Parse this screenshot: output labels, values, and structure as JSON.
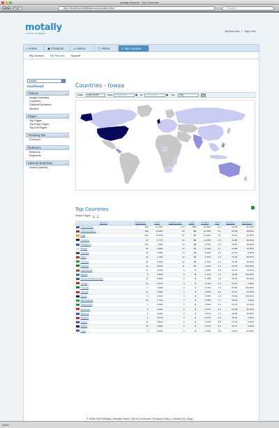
{
  "window": {
    "title": "motally Reports - Top Countries"
  },
  "browser": {
    "url": "http://localhost:8888/demo/countries.html",
    "search_placeholder": "Google",
    "status": "Done"
  },
  "brand": {
    "logo": "motally",
    "tagline": "mobile analytics"
  },
  "toplinks": {
    "account": "My Account",
    "separator": "|",
    "signout": "Sign Out"
  },
  "tabs": [
    "Home",
    "Products",
    "Demo",
    "About",
    "My Account"
  ],
  "subnav": [
    "My Account",
    "My Reports",
    "Support"
  ],
  "sidebar": {
    "select_value": "towza",
    "dashboard": "Dashboard",
    "sections": [
      {
        "title": "Visitors",
        "items": [
          "Usage Summary",
          "Countries",
          "Carriers/Operators",
          "Devices"
        ]
      },
      {
        "title": "Pages",
        "items": [
          "Top Pages",
          "Top Entry Pages",
          "Top Exit Pages"
        ]
      },
      {
        "title": "Tracking IDs",
        "items": [
          "Overview"
        ]
      },
      {
        "title": "Referrers",
        "items": [
          "Referrers",
          "Keywords"
        ]
      },
      {
        "title": "Internal Searches",
        "items": [
          "Search Queries"
        ]
      }
    ]
  },
  "main": {
    "title": "Countries - towza",
    "date": {
      "label": "Date:",
      "preset": "Last month",
      "from_label": "from:",
      "from": "10/01/2008",
      "to_label": "to:",
      "to": "10/27/2008",
      "by_label": "by:",
      "by": "Day",
      "go": "Go"
    },
    "table_title": "Top Countries",
    "pages_label": "Result Pages:",
    "page_nums": [
      "1",
      "2"
    ]
  },
  "colors": {
    "accent": "#2b6fb0",
    "map_high": "#0a0a5c",
    "map_mid": "#8f92d8",
    "map_low": "#c9cbf0",
    "map_none": "#c8c8c8"
  },
  "table": {
    "columns": [
      "Country",
      "Pageviews",
      "% PV",
      "Unique Users",
      "Visits",
      "% Visits",
      "PPV",
      "Avg Time",
      "Bounce %"
    ],
    "rows": [
      [
        "United States",
        "366",
        "27.23%",
        "173",
        "173",
        "31.96%",
        "2.1",
        "00:48",
        "67.63%"
      ],
      [
        "United Kingdom",
        "189",
        "14.08%",
        "89",
        "89",
        "16.39%",
        "2.1",
        "00:56",
        "68.54%"
      ],
      [
        "India",
        "264",
        "19.64%",
        "67",
        "67",
        "12.34%",
        "3.9",
        "03:21",
        "34.33%"
      ],
      [
        "Germany",
        "91",
        "6.77%",
        "60",
        "60",
        "11.05%",
        "1.5",
        "00:05",
        "90.00%"
      ],
      [
        "Philippines",
        "100",
        "7.44%",
        "19",
        "19",
        "3.50%",
        "5.3",
        "05:03",
        "36.84%"
      ],
      [
        "Russia",
        "35",
        "2.60%",
        "17",
        "17",
        "3.13%",
        "2.1",
        "00:08",
        "70.59%"
      ],
      [
        "Australia",
        "32",
        "2.38%",
        "13",
        "13",
        "2.39%",
        "2.5",
        "01:20",
        "0.00%"
      ],
      [
        "China",
        "16",
        "1.19%",
        "12",
        "12",
        "2.21%",
        "1.3",
        "00:02",
        "66.67%"
      ],
      [
        "Jamaica",
        "41",
        "3.05%",
        "12",
        "12",
        "2.21%",
        "3.4",
        "02:04",
        "33.33%"
      ],
      [
        "Pakistan",
        "11",
        "0.82%",
        "11",
        "11",
        "2.03%",
        "1.0",
        "00:00",
        "100.00%"
      ],
      [
        "Netherlands",
        "27",
        "2.01%",
        "9",
        "9",
        "1.66%",
        "3.0",
        "00:10",
        "11.11%"
      ],
      [
        "Nigeria",
        "8",
        "0.60%",
        "8",
        "8",
        "1.47%",
        "1.0",
        "00:00",
        "100.00%"
      ],
      [
        "Serbia and Montenegro",
        "11",
        "0.82%",
        "6",
        "6",
        "1.10%",
        "1.8",
        "00:41",
        "50.00%"
      ],
      [
        "Tunisia",
        "13",
        "0.97%",
        "4",
        "4",
        "0.74%",
        "3.2",
        "03:07",
        "0.00%"
      ],
      [
        "Portugal",
        "4",
        "0.30%",
        "4",
        "4",
        "0.74%",
        "1.0",
        "00:00",
        "100.00%"
      ],
      [
        "Canada",
        "12",
        "0.89%",
        "3",
        "3",
        "0.55%",
        "4.0",
        "00:37",
        "33.33%"
      ],
      [
        "Kenya",
        "3",
        "0.22%",
        "3",
        "3",
        "0.55%",
        "1.0",
        "00:00",
        "100.00%"
      ],
      [
        "Mozambique",
        "23",
        "1.71%",
        "3",
        "3",
        "0.55%",
        "7.7",
        "08:19",
        "0.00%"
      ],
      [
        "South Africa",
        "7",
        "0.52%",
        "3",
        "3",
        "0.55%",
        "2.3",
        "01:34",
        "33.33%"
      ],
      [
        "Indonesia",
        "4",
        "0.30%",
        "2",
        "2",
        "0.37%",
        "2.0",
        "03:03",
        "50.00%"
      ],
      [
        "Moldova",
        "3",
        "0.22%",
        "2",
        "2",
        "0.37%",
        "1.5",
        "00:00",
        "50.00%"
      ],
      [
        "Panama",
        "9",
        "0.67%",
        "2",
        "2",
        "0.37%",
        "4.5",
        "00:01",
        "0.00%"
      ],
      [
        "France",
        "11",
        "0.82%",
        "2",
        "2",
        "0.37%",
        "5.5",
        "07:35",
        "0.00%"
      ],
      [
        "Malawi",
        "12",
        "0.89%",
        "2",
        "2",
        "0.37%",
        "6.0",
        "02:47",
        "0.00%"
      ],
      [
        "Israel",
        "3",
        "0.22%",
        "2",
        "2",
        "0.37%",
        "1.5",
        "00:01",
        "50.00%"
      ]
    ]
  },
  "footer": {
    "copyright": "© 2008-2009 Motally",
    "links": [
      "Motally Home",
      "Terms of Service",
      "Privacy Policy",
      "Contact Us",
      "Blog"
    ]
  }
}
